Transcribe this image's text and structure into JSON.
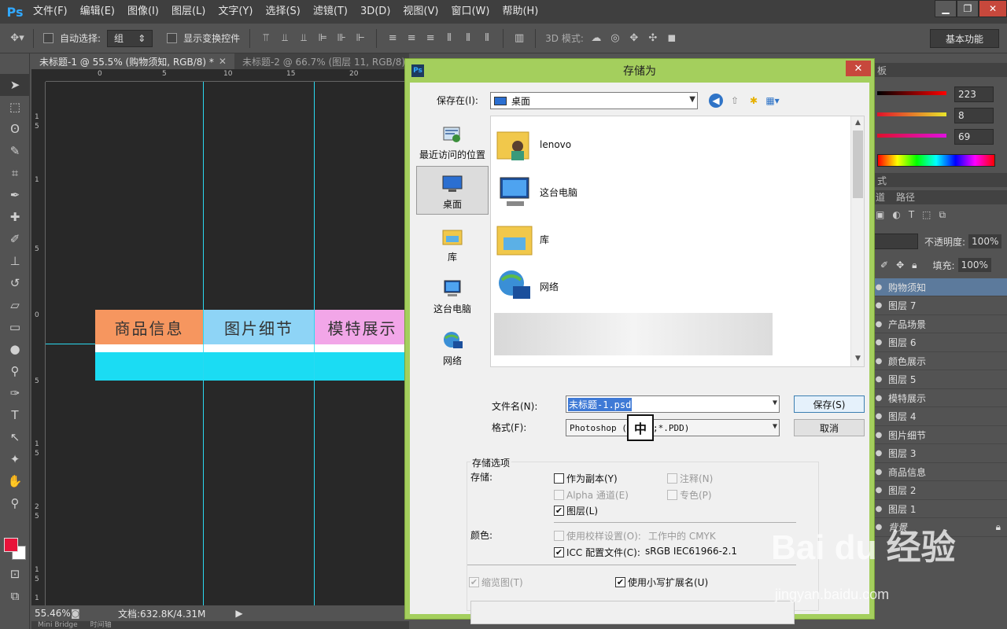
{
  "menubar": {
    "logo": "Ps",
    "items": [
      "文件(F)",
      "编辑(E)",
      "图像(I)",
      "图层(L)",
      "文字(Y)",
      "选择(S)",
      "滤镜(T)",
      "3D(D)",
      "视图(V)",
      "窗口(W)",
      "帮助(H)"
    ]
  },
  "options": {
    "auto_select": "自动选择:",
    "group_value": "组",
    "show_transform": "显示变换控件",
    "mode_3d": "3D 模式:",
    "workspace": "基本功能"
  },
  "tabs": [
    {
      "label": "未标题-1 @ 55.5% (购物须知, RGB/8) *"
    },
    {
      "label": "未标题-2 @ 66.7% (图层 11, RGB/8) *"
    }
  ],
  "ruler_h": [
    "0",
    "5",
    "10",
    "15",
    "20"
  ],
  "ruler_v": [
    "1",
    "5",
    "1",
    "5",
    "0",
    "5",
    "1",
    "5",
    "2",
    "5",
    "1",
    "5",
    "1"
  ],
  "canvas": {
    "nav": [
      {
        "label": "商品信息",
        "color": "#f6965f"
      },
      {
        "label": "图片细节",
        "color": "#8ed4f6"
      },
      {
        "label": "模特展示",
        "color": "#f2a6e8"
      }
    ]
  },
  "status": {
    "zoom": "55.46%",
    "doc": "文档:632.8K/4.31M",
    "bottom_tabs": [
      "Mini Bridge",
      "时间轴"
    ]
  },
  "right": {
    "panel_label": "板",
    "sliders": [
      {
        "value": "223"
      },
      {
        "value": "8"
      },
      {
        "value": "69"
      }
    ],
    "section2": "式",
    "tabs": [
      "道",
      "路径"
    ],
    "opacity_label": "不透明度:",
    "opacity_value": "100%",
    "fill_label": "填充:",
    "fill_value": "100%",
    "layers": [
      "购物须知",
      "图层 7",
      "产品场景",
      "图层 6",
      "颜色展示",
      "图层 5",
      "模特展示",
      "图层 4",
      "图片细节",
      "图层 3",
      "商品信息",
      "图层 2",
      "图层 1",
      "背景"
    ]
  },
  "dialog": {
    "title": "存储为",
    "icon": "Ps",
    "save_in_label": "保存在(I):",
    "save_in_value": "桌面",
    "places": [
      "最近访问的位置",
      "桌面",
      "库",
      "这台电脑",
      "网络"
    ],
    "files": [
      "lenovo",
      "这台电脑",
      "库",
      "网络"
    ],
    "filename_label": "文件名(N):",
    "filename_value": "未标题-1.psd",
    "format_label": "格式(F):",
    "format_value": "Photoshop (*.PSD;*.PDD)",
    "ime": "中",
    "save_btn": "保存(S)",
    "cancel_btn": "取消",
    "options_title": "存储选项",
    "save_label": "存储:",
    "as_copy": "作为副本(Y)",
    "notes": "注释(N)",
    "alpha": "Alpha 通道(E)",
    "spot": "专色(P)",
    "layers": "图层(L)",
    "color_label": "颜色:",
    "proof": "使用校样设置(O):",
    "proof_value": "工作中的 CMYK",
    "icc": "ICC 配置文件(C):",
    "icc_value": "sRGB IEC61966-2.1",
    "thumbnail": "缩览图(T)",
    "lowercase_ext": "使用小写扩展名(U)"
  },
  "watermark": {
    "brand": "Bai du 经验",
    "url": "jingyan.baidu.com"
  }
}
